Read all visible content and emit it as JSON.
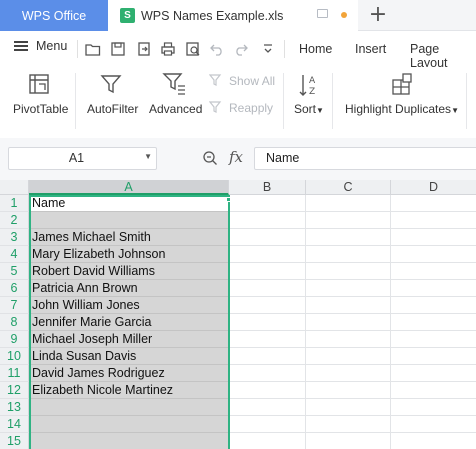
{
  "tabs": {
    "home": "WPS Office",
    "document": "WPS Names Example.xls",
    "add": "+"
  },
  "menu": {
    "menu_label": "Menu",
    "tabs": [
      "Home",
      "Insert",
      "Page Layout"
    ]
  },
  "ribbon": {
    "pivot": "PivotTable",
    "autofilter": "AutoFilter",
    "advanced": "Advanced",
    "show_all": "Show All",
    "reapply": "Reapply",
    "sort": "Sort",
    "highlight": "Highlight Duplicates"
  },
  "formula_bar": {
    "name_box": "A1",
    "fx": "fx",
    "content": "Name"
  },
  "grid": {
    "columns": [
      "A",
      "B",
      "C",
      "D"
    ],
    "rows": [
      "1",
      "2",
      "3",
      "4",
      "5",
      "6",
      "7",
      "8",
      "9",
      "10",
      "11",
      "12",
      "13",
      "14",
      "15"
    ],
    "column_a": [
      "Name",
      "",
      "James Michael Smith",
      "Mary Elizabeth Johnson",
      "Robert David Williams",
      "Patricia Ann Brown",
      "John William Jones",
      "Jennifer Marie Garcia",
      "Michael Joseph Miller",
      "Linda Susan Davis",
      "David James Rodriguez",
      "Elizabeth Nicole Martinez",
      "",
      "",
      ""
    ]
  },
  "colors": {
    "accent_green": "#1f9f68",
    "tab_blue": "#5b8ee8",
    "selection_fill": "#d6d6d6"
  }
}
